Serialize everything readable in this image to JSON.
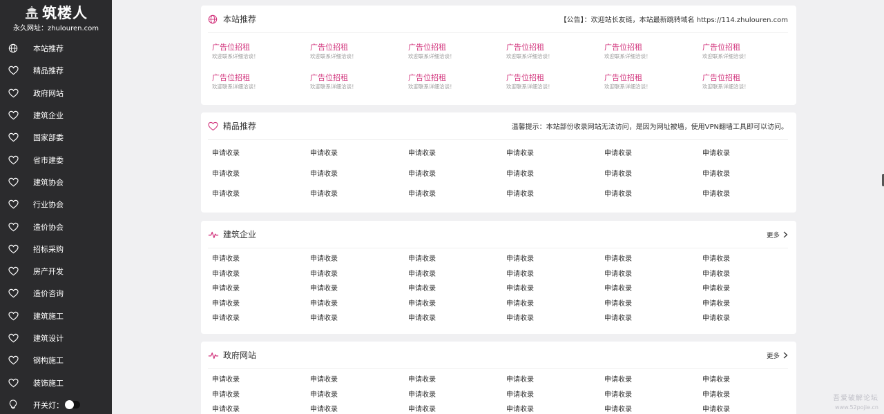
{
  "sidebar": {
    "logo_text": "筑楼人",
    "site_url": "永久网址：zhulouren.com",
    "items": [
      {
        "label": "本站推荐",
        "icon": "globe-icon"
      },
      {
        "label": "精品推荐",
        "icon": "heart-icon"
      },
      {
        "label": "政府网站",
        "icon": "heart-icon"
      },
      {
        "label": "建筑企业",
        "icon": "heart-icon"
      },
      {
        "label": "国家部委",
        "icon": "heart-icon"
      },
      {
        "label": "省市建委",
        "icon": "heart-icon"
      },
      {
        "label": "建筑协会",
        "icon": "heart-icon"
      },
      {
        "label": "行业协会",
        "icon": "heart-icon"
      },
      {
        "label": "造价协会",
        "icon": "heart-icon"
      },
      {
        "label": "招标采购",
        "icon": "heart-icon"
      },
      {
        "label": "房产开发",
        "icon": "heart-icon"
      },
      {
        "label": "造价咨询",
        "icon": "heart-icon"
      },
      {
        "label": "建筑施工",
        "icon": "heart-icon"
      },
      {
        "label": "建筑设计",
        "icon": "heart-icon"
      },
      {
        "label": "钢构施工",
        "icon": "heart-icon"
      },
      {
        "label": "装饰施工",
        "icon": "heart-icon"
      }
    ],
    "light_toggle_label": "开关灯："
  },
  "sections": {
    "recommend": {
      "title": "本站推荐",
      "notice": "【公告】：欢迎站长友链，本站最新跳转域名 https://114.zhulouren.com",
      "ad_title": "广告位招租",
      "ad_sub": "欢迎联系详细洽谈！"
    },
    "picks": {
      "title": "精品推荐",
      "notice": "温馨提示：本站部份收录网站无法访问，是因为网址被墙，使用VPN翻墙工具即可以访问。",
      "link_label": "申请收录"
    },
    "companies": {
      "title": "建筑企业",
      "more": "更多",
      "link_label": "申请收录"
    },
    "government": {
      "title": "政府网站",
      "more": "更多",
      "link_label": "申请收录"
    }
  },
  "watermark": {
    "line1": "吾爱破解论坛",
    "line2": "www.52pojie.cn"
  },
  "colors": {
    "sidebar_bg": "#2b2b2d",
    "accent": "#d2357d",
    "page_bg": "#f0f0f2"
  }
}
